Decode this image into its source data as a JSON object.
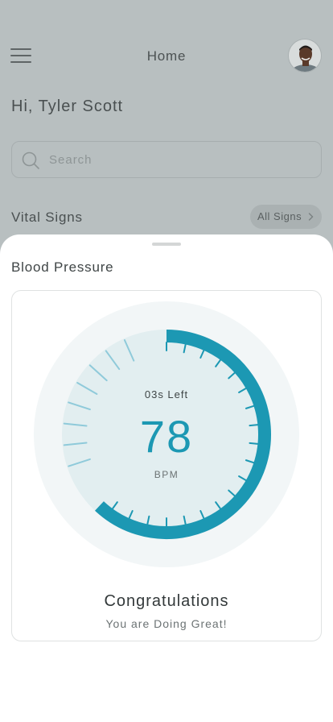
{
  "header": {
    "title": "Home",
    "menu_icon": "hamburger-menu-icon",
    "avatar_icon": "user-avatar"
  },
  "greeting": "Hi, Tyler Scott",
  "search": {
    "placeholder": "Search",
    "icon": "search-icon"
  },
  "vital_signs": {
    "title": "Vital Signs",
    "all_signs_label": "All Signs",
    "chevron_icon": "chevron-right-icon"
  },
  "sheet": {
    "title": "Blood Pressure",
    "gauge": {
      "time_left": "03s Left",
      "value": "78",
      "unit": "BPM",
      "progress": 0.62
    },
    "message_title": "Congratulations",
    "message_subtitle": "You are Doing Great!"
  },
  "colors": {
    "accent": "#1c98b3",
    "accent_light": "#8fcada",
    "gauge_outer": "#f2f6f7",
    "gauge_inner": "#e2eef0",
    "overlay": "#b8bfc0"
  }
}
